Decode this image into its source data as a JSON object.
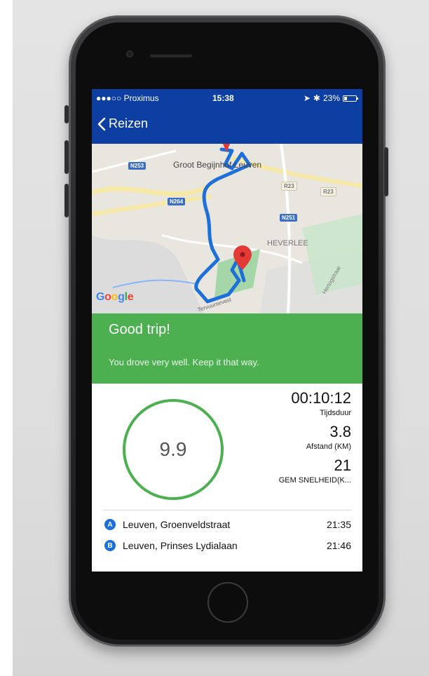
{
  "status_bar": {
    "carrier": "●●●○○ Proximus",
    "time": "15:38",
    "battery_text": "23%",
    "battery_level": 0.23
  },
  "nav": {
    "back_label": "Reizen"
  },
  "map": {
    "labels": {
      "poi": "Groot Begijnhof Leuven",
      "district": "HEVERLEE",
      "street1": "Tervuursevest",
      "street2": "Hertogstraat"
    },
    "roads": {
      "n253": "N253",
      "n264": "N264",
      "n251": "N251",
      "r23a": "R23",
      "r23b": "R23"
    },
    "google": "Google",
    "colors": {
      "route": "#1e6fd9",
      "pin": "#e53935"
    }
  },
  "banner": {
    "title": "Good trip!",
    "subtitle": "You drove very well. Keep it that way.",
    "color": "#4caf50"
  },
  "score": {
    "value": "9.9"
  },
  "stats": [
    {
      "value": "00:10:12",
      "label": "Tijdsduur"
    },
    {
      "value": "3.8",
      "label": "Afstand (KM)"
    },
    {
      "value": "21",
      "label": "GEM SNELHEID(K..."
    }
  ],
  "stops": [
    {
      "badge": "A",
      "name": "Leuven, Groenveldstraat",
      "time": "21:35"
    },
    {
      "badge": "B",
      "name": "Leuven, Prinses Lydialaan",
      "time": "21:46"
    }
  ]
}
